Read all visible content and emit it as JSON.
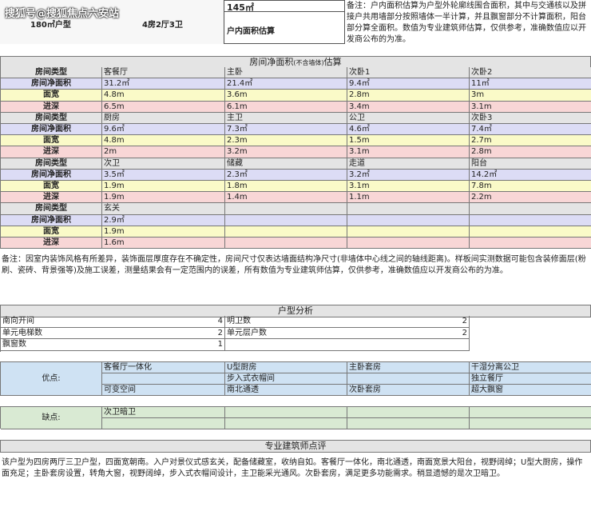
{
  "header": {
    "watermark": "搜狐号@搜狐焦点六安站",
    "area_type": "180㎡户型",
    "layout": "4房2厅3卫",
    "inner_area_value": "145㎡",
    "inner_area_label": "户内面积估算",
    "note": "备注：户内面积估算为户型外轮廓线围合面积，其中与交通核以及拼接户共用墙部分按照墙体一半计算，并且飘窗部分不计算面积，阳台部分算全面积。数值为专业建筑师估算，仅供参考，准确数值应以开发商公布的为准。"
  },
  "room_section": {
    "title": "房间净面积",
    "title_small": "(不含墙体)",
    "title_end": "估算",
    "row_labels": [
      "房间类型",
      "房间净面积",
      "面宽",
      "进深"
    ],
    "groups": [
      {
        "types": [
          "客餐厅",
          "主卧",
          "次卧1",
          "次卧2"
        ],
        "areas": [
          "31.2㎡",
          "21.4㎡",
          "9.4㎡",
          "11㎡"
        ],
        "widths": [
          "4.8m",
          "3.6m",
          "2.8m",
          "3m"
        ],
        "depths": [
          "6.5m",
          "6.1m",
          "3.4m",
          "3.1m"
        ]
      },
      {
        "types": [
          "厨房",
          "主卫",
          "公卫",
          "次卧3"
        ],
        "areas": [
          "9.6㎡",
          "7.3㎡",
          "4.6㎡",
          "7.4㎡"
        ],
        "widths": [
          "4.8m",
          "2.3m",
          "1.5m",
          "2.7m"
        ],
        "depths": [
          "2m",
          "3.2m",
          "3.1m",
          "2.8m"
        ]
      },
      {
        "types": [
          "次卫",
          "储藏",
          "走道",
          "阳台"
        ],
        "areas": [
          "3.5㎡",
          "2.3㎡",
          "3.2㎡",
          "14.2㎡"
        ],
        "widths": [
          "1.9m",
          "1.8m",
          "3.1m",
          "7.8m"
        ],
        "depths": [
          "1.9m",
          "1.4m",
          "1.1m",
          "2.2m"
        ]
      },
      {
        "types": [
          "玄关",
          "",
          "",
          ""
        ],
        "areas": [
          "2.9㎡",
          "",
          "",
          ""
        ],
        "widths": [
          "1.9m",
          "",
          "",
          ""
        ],
        "depths": [
          "1.6m",
          "",
          "",
          ""
        ]
      }
    ],
    "note": "备注：因室内装饰风格有所差异，装饰面层厚度存在不确定性，房间尺寸仅表达墙面结构净尺寸(非墙体中心线之间的轴线距离)。样板间实测数据可能包含装修面层(粉刷、瓷砖、背景强等)及施工误差，测量结果会有一定范围内的误差，所有数值为专业建筑师估算，仅供参考，准确数值应以开发商公布的为准。"
  },
  "analysis": {
    "title": "户型分析",
    "rows": [
      {
        "l_label": "南向开间",
        "l_value": "4",
        "r_label": "明卫数",
        "r_value": "2"
      },
      {
        "l_label": "单元电梯数",
        "l_value": "2",
        "r_label": "单元层户数",
        "r_value": "2"
      },
      {
        "l_label": "飘窗数",
        "l_value": "1",
        "r_label": "",
        "r_value": ""
      }
    ]
  },
  "pros": {
    "label": "优点:",
    "rows": [
      [
        "客餐厅一体化",
        "U型厨房",
        "主卧套房",
        "干湿分离公卫"
      ],
      [
        "",
        "步入式衣帽间",
        "",
        "独立餐厅"
      ],
      [
        "可变空间",
        "南北通透",
        "次卧套房",
        "超大飘窗"
      ]
    ]
  },
  "cons": {
    "label": "缺点:",
    "rows": [
      [
        "次卫暗卫",
        "",
        "",
        ""
      ],
      [
        "",
        "",
        "",
        ""
      ]
    ]
  },
  "review": {
    "title": "专业建筑师点评",
    "text": "该户型为四房两厅三卫户型，四面宽朝南。入户对景仪式感玄关，配备储藏室，收纳自如。客餐厅一体化，南北通透，南面宽景大阳台，视野阔绰；U型大厨房，操作面充足；主卧套房设置，转角大窗，视野阔绰，步入式衣帽间设计，主卫能采光通风。次卧套房，满足更多功能需求。稍显遗憾的是次卫暗卫。"
  }
}
